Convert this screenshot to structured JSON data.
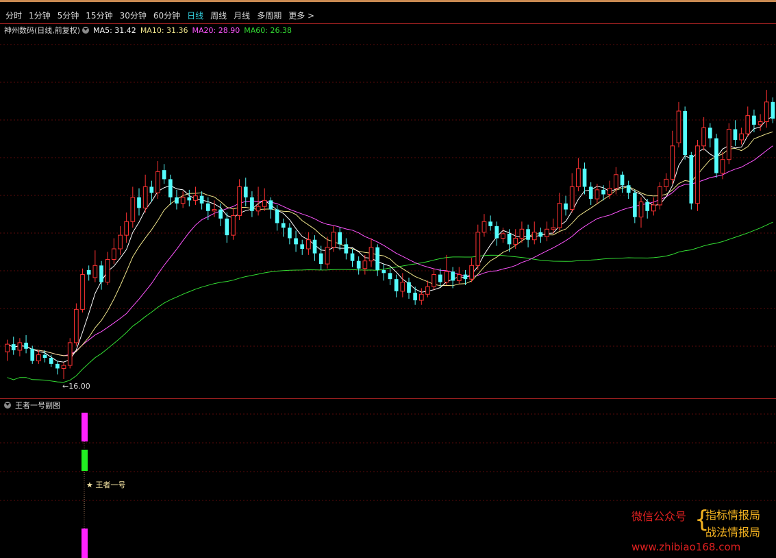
{
  "toolbar": {
    "items": [
      "分时",
      "1分钟",
      "5分钟",
      "15分钟",
      "30分钟",
      "60分钟",
      "日线",
      "周线",
      "月线",
      "多周期",
      "更多 >"
    ],
    "active_index": 6
  },
  "legend": {
    "stock": "神州数码(日线,前复权)",
    "ma5": "MA5: 31.42",
    "ma10": "MA10: 31.36",
    "ma20": "MA20: 28.90",
    "ma60": "MA60: 26.38"
  },
  "colors": {
    "up": "#ff3232",
    "down": "#54fcfc",
    "ma5": "#ffffff",
    "ma10": "#f0e68c",
    "ma20": "#ff55ff",
    "ma60": "#33dd33",
    "grid": "#5a0a0a"
  },
  "sub_chart": {
    "title": "王者一号副图",
    "label": "★ 王者一号"
  },
  "watermark": {
    "wechat": "微信公众号",
    "name1": "指标情报局",
    "name2": "战法情报局",
    "url": "www.zhibiao168.com"
  },
  "chart_data": {
    "type": "candlestick",
    "ylim": [
      15,
      39
    ],
    "low_label": "16.00",
    "candles": [
      [
        17.8,
        18.3,
        17.2,
        18.6
      ],
      [
        18.3,
        17.9,
        17.6,
        18.8
      ],
      [
        17.9,
        18.4,
        17.5,
        18.7
      ],
      [
        18.4,
        18.0,
        17.7,
        18.9
      ],
      [
        18.0,
        17.2,
        17.0,
        18.2
      ],
      [
        17.2,
        17.6,
        17.0,
        17.9
      ],
      [
        17.6,
        17.4,
        17.1,
        17.9
      ],
      [
        17.4,
        17.0,
        16.8,
        17.6
      ],
      [
        17.0,
        16.7,
        16.3,
        17.2
      ],
      [
        16.7,
        16.9,
        16.0,
        17.1
      ],
      [
        16.9,
        18.4,
        16.7,
        18.7
      ],
      [
        18.4,
        20.6,
        18.2,
        21.0
      ],
      [
        20.6,
        22.9,
        20.4,
        23.3
      ],
      [
        23.2,
        22.9,
        22.5,
        23.5
      ],
      [
        22.7,
        23.5,
        22.4,
        24.5
      ],
      [
        23.5,
        22.4,
        21.9,
        23.8
      ],
      [
        22.4,
        23.9,
        22.2,
        24.4
      ],
      [
        23.9,
        24.6,
        23.6,
        25.3
      ],
      [
        24.6,
        25.5,
        24.2,
        26.1
      ],
      [
        25.5,
        26.4,
        25.0,
        27.0
      ],
      [
        26.4,
        28.0,
        26.0,
        28.7
      ],
      [
        28.0,
        27.3,
        26.8,
        28.6
      ],
      [
        27.3,
        28.7,
        27.0,
        29.5
      ],
      [
        28.7,
        28.3,
        27.7,
        29.1
      ],
      [
        28.3,
        29.7,
        27.9,
        30.4
      ],
      [
        29.8,
        29.2,
        28.9,
        30.2
      ],
      [
        29.2,
        28.0,
        27.5,
        29.5
      ],
      [
        28.0,
        27.6,
        27.2,
        28.5
      ],
      [
        27.6,
        28.0,
        27.3,
        28.4
      ],
      [
        28.0,
        27.8,
        27.4,
        28.5
      ],
      [
        27.8,
        28.1,
        27.5,
        28.7
      ],
      [
        28.1,
        27.6,
        27.2,
        28.4
      ],
      [
        27.6,
        27.1,
        26.5,
        28.0
      ],
      [
        27.1,
        27.2,
        26.7,
        27.8
      ],
      [
        27.2,
        26.6,
        26.1,
        27.6
      ],
      [
        26.6,
        25.5,
        25.0,
        27.0
      ],
      [
        25.5,
        26.8,
        25.2,
        27.3
      ],
      [
        26.8,
        28.7,
        26.5,
        29.2
      ],
      [
        28.7,
        28.0,
        27.4,
        29.3
      ],
      [
        28.0,
        27.1,
        26.7,
        28.4
      ],
      [
        27.1,
        27.4,
        26.8,
        28.7
      ],
      [
        27.4,
        27.8,
        27.1,
        28.6
      ],
      [
        27.8,
        27.2,
        26.6,
        28.0
      ],
      [
        27.2,
        26.3,
        25.8,
        27.5
      ],
      [
        26.3,
        26.0,
        25.4,
        26.6
      ],
      [
        26.0,
        25.3,
        24.9,
        26.3
      ],
      [
        25.3,
        24.9,
        24.4,
        25.8
      ],
      [
        24.9,
        24.6,
        24.2,
        25.2
      ],
      [
        24.6,
        25.2,
        24.2,
        25.7
      ],
      [
        25.2,
        24.3,
        23.8,
        25.5
      ],
      [
        24.3,
        23.6,
        23.2,
        24.8
      ],
      [
        23.6,
        24.7,
        23.3,
        25.4
      ],
      [
        24.7,
        25.7,
        24.4,
        26.1
      ],
      [
        25.7,
        24.9,
        24.5,
        26.0
      ],
      [
        24.9,
        24.3,
        23.9,
        25.3
      ],
      [
        24.3,
        23.8,
        23.4,
        24.6
      ],
      [
        23.8,
        23.3,
        22.9,
        24.1
      ],
      [
        23.3,
        23.8,
        22.9,
        24.2
      ],
      [
        23.8,
        24.7,
        23.4,
        25.3
      ],
      [
        24.7,
        23.2,
        22.8,
        24.9
      ],
      [
        23.2,
        23.0,
        22.5,
        23.6
      ],
      [
        23.0,
        22.6,
        22.2,
        23.3
      ],
      [
        22.6,
        21.8,
        21.4,
        22.9
      ],
      [
        21.8,
        22.4,
        21.4,
        23.0
      ],
      [
        22.4,
        21.7,
        21.3,
        22.7
      ],
      [
        21.7,
        21.2,
        20.9,
        22.1
      ],
      [
        21.2,
        21.6,
        20.9,
        22.0
      ],
      [
        21.6,
        22.1,
        21.4,
        22.5
      ],
      [
        22.1,
        22.9,
        21.9,
        23.3
      ],
      [
        22.9,
        22.4,
        22.1,
        23.3
      ],
      [
        22.4,
        23.1,
        22.2,
        24.2
      ],
      [
        23.1,
        22.5,
        22.0,
        23.4
      ],
      [
        22.5,
        22.9,
        22.3,
        23.4
      ],
      [
        22.9,
        22.6,
        22.2,
        23.2
      ],
      [
        22.6,
        23.5,
        22.4,
        24.0
      ],
      [
        23.5,
        25.7,
        23.2,
        26.2
      ],
      [
        25.7,
        26.4,
        25.4,
        26.9
      ],
      [
        26.4,
        26.1,
        25.8,
        26.8
      ],
      [
        26.1,
        25.3,
        24.8,
        26.4
      ],
      [
        25.3,
        25.6,
        25.0,
        26.0
      ],
      [
        25.6,
        24.9,
        24.4,
        25.9
      ],
      [
        24.9,
        25.3,
        24.6,
        25.9
      ],
      [
        25.3,
        25.9,
        25.0,
        26.4
      ],
      [
        25.9,
        25.2,
        24.7,
        26.2
      ],
      [
        25.2,
        25.7,
        24.9,
        26.4
      ],
      [
        25.7,
        25.4,
        25.0,
        26.0
      ],
      [
        25.4,
        25.9,
        25.1,
        26.4
      ],
      [
        25.9,
        26.0,
        25.6,
        26.6
      ],
      [
        26.0,
        27.6,
        25.8,
        28.3
      ],
      [
        27.6,
        27.2,
        26.8,
        28.1
      ],
      [
        27.2,
        28.7,
        27.0,
        29.6
      ],
      [
        28.7,
        29.9,
        28.4,
        30.6
      ],
      [
        29.9,
        28.7,
        28.2,
        30.3
      ],
      [
        28.7,
        27.9,
        27.5,
        29.0
      ],
      [
        27.9,
        28.5,
        27.6,
        28.9
      ],
      [
        28.5,
        28.2,
        27.8,
        28.8
      ],
      [
        28.2,
        28.6,
        27.9,
        29.1
      ],
      [
        28.6,
        29.5,
        28.2,
        30.0
      ],
      [
        29.5,
        28.8,
        28.3,
        29.7
      ],
      [
        28.8,
        28.3,
        27.9,
        29.1
      ],
      [
        28.3,
        26.7,
        26.3,
        28.5
      ],
      [
        26.7,
        27.7,
        26.0,
        28.0
      ],
      [
        27.7,
        27.1,
        26.6,
        27.9
      ],
      [
        27.1,
        27.5,
        26.8,
        28.0
      ],
      [
        27.5,
        28.7,
        27.2,
        29.0
      ],
      [
        28.7,
        29.2,
        28.4,
        29.6
      ],
      [
        29.2,
        31.4,
        28.9,
        32.4
      ],
      [
        31.6,
        33.7,
        31.3,
        34.3
      ],
      [
        33.7,
        30.8,
        30.5,
        34.0
      ],
      [
        30.8,
        27.6,
        27.2,
        31.0
      ],
      [
        27.6,
        31.4,
        27.1,
        31.8
      ],
      [
        31.4,
        32.6,
        31.1,
        33.3
      ],
      [
        32.6,
        31.9,
        31.3,
        32.9
      ],
      [
        31.9,
        29.6,
        29.3,
        32.2
      ],
      [
        29.6,
        30.5,
        29.2,
        31.0
      ],
      [
        30.5,
        32.5,
        30.2,
        32.9
      ],
      [
        32.5,
        31.8,
        31.4,
        33.1
      ],
      [
        31.8,
        32.2,
        31.5,
        32.6
      ],
      [
        32.2,
        33.4,
        32.0,
        34.0
      ],
      [
        33.4,
        32.8,
        32.3,
        33.8
      ],
      [
        32.8,
        33.0,
        32.4,
        33.5
      ],
      [
        33.0,
        34.3,
        32.6,
        35.1
      ],
      [
        34.3,
        33.2,
        32.9,
        34.6
      ]
    ]
  }
}
